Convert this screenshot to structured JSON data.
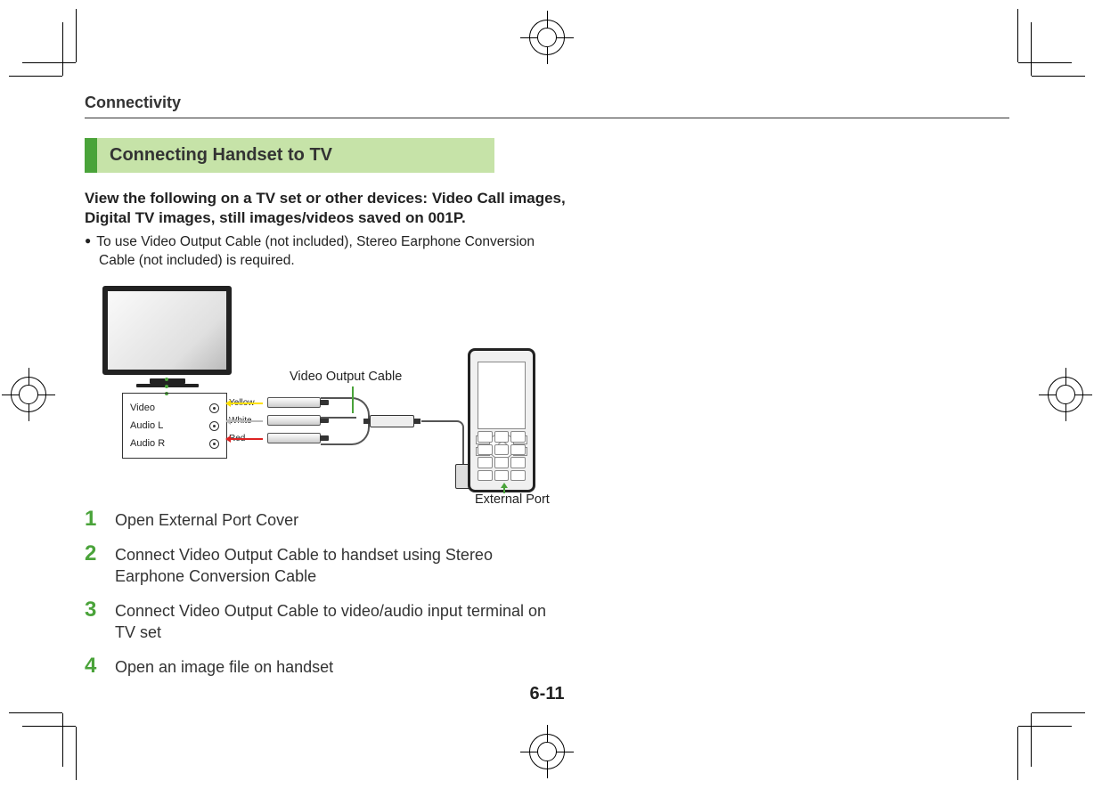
{
  "running_header": "Connectivity",
  "section_title": "Connecting Handset to TV",
  "intro": "View the following on a TV set or other devices: Video Call images, Digital TV images, still images/videos saved on 001P.",
  "bullet": "To use Video Output Cable (not included), Stereo Earphone Conversion Cable (not included) is required.",
  "diagram": {
    "video_output_cable_label": "Video Output Cable",
    "external_port_label": "External Port",
    "panel": {
      "video": "Video",
      "audio_l": "Audio L",
      "audio_r": "Audio R"
    },
    "colors": {
      "yellow": "Yellow",
      "white": "White",
      "red": "Red"
    }
  },
  "steps": [
    {
      "num": "1",
      "text": "Open External Port Cover"
    },
    {
      "num": "2",
      "text": "Connect Video Output Cable to handset using Stereo Earphone Conversion Cable"
    },
    {
      "num": "3",
      "text": "Connect Video Output Cable to video/audio input terminal on TV set"
    },
    {
      "num": "4",
      "text": "Open an image file on handset"
    }
  ],
  "page_number": "6-11"
}
